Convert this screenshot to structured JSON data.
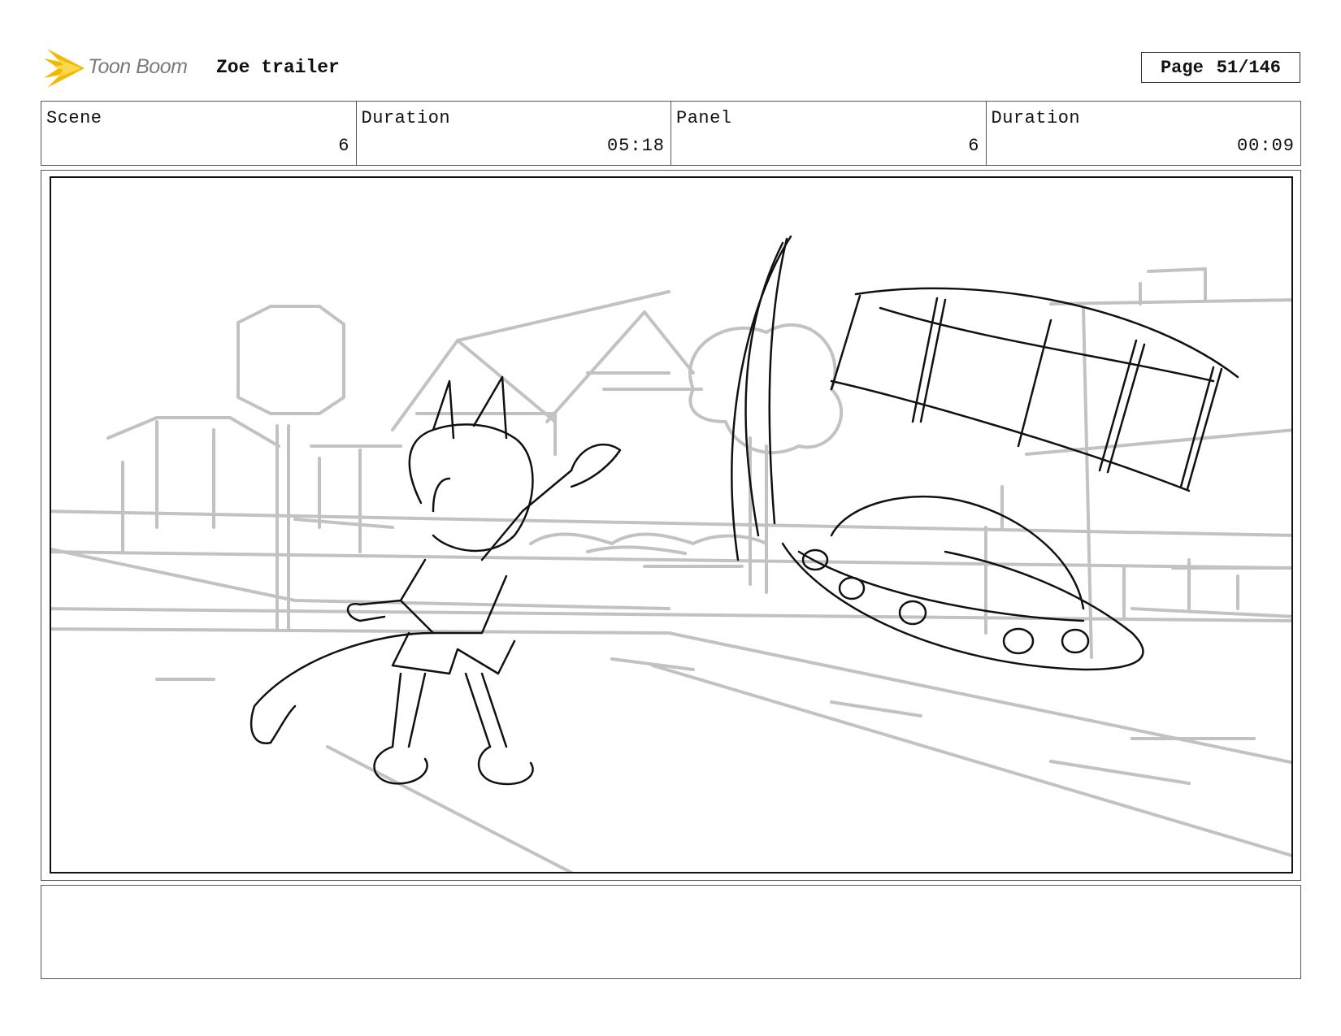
{
  "header": {
    "logo_text": "Toon Boom",
    "project_title": "Zoe trailer",
    "page_label": "Page",
    "page_number": "51/146"
  },
  "info": {
    "scene_label": "Scene",
    "scene_value": "6",
    "scene_duration_label": "Duration",
    "scene_duration_value": "05:18",
    "panel_label": "Panel",
    "panel_value": "6",
    "panel_duration_label": "Duration",
    "panel_duration_value": "00:09"
  },
  "colors": {
    "logo_flame": "#f5b800",
    "background_sketch": "#c2c2c2",
    "foreground_sketch": "#111111"
  },
  "notes": {
    "text": ""
  }
}
